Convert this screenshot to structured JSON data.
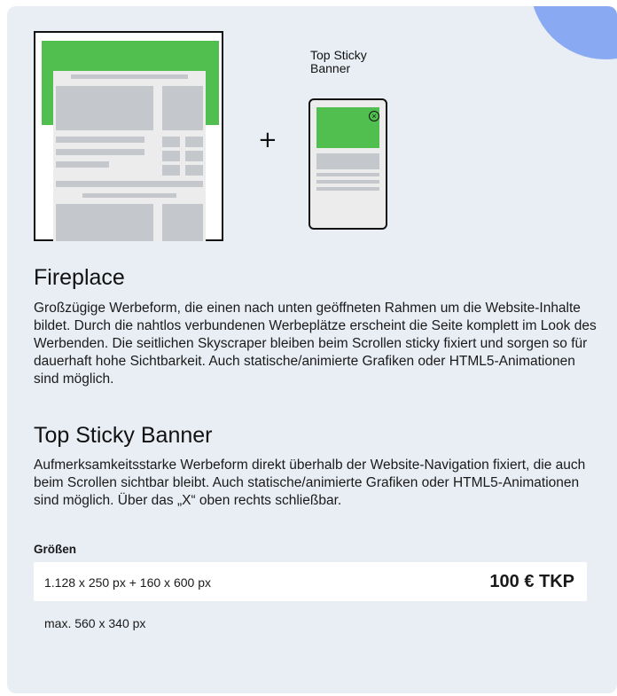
{
  "illustration": {
    "plus_symbol": "+",
    "sticky_label_line1": "Top Sticky",
    "sticky_label_line2": "Banner",
    "close_symbol": "×"
  },
  "sections": [
    {
      "title": "Fireplace",
      "text": "Großzügige Werbeform, die einen nach unten geöffneten Rahmen um die Website-Inhalte bildet. Durch die nahtlos verbundenen Werbeplätze erscheint die Seite komplett im Look des Werbenden. Die seitlichen Skyscraper bleiben beim Scrollen sticky fixiert und sorgen so für dauerhaft hohe Sichtbarkeit. Auch statische/animierte Grafiken oder HTML5-Animationen sind möglich."
    },
    {
      "title": "Top Sticky Banner",
      "text": "Aufmerksamkeitsstarke Werbeform direkt überhalb der Website-Navigation fixiert, die auch beim Scrollen sichtbar bleibt. Auch statische/animierte Grafiken oder HTML5-Animationen sind möglich. Über das „X“ oben rechts schließbar."
    }
  ],
  "sizes": {
    "label": "Größen",
    "primary": "1.128 x 250 px + 160 x 600 px",
    "price": "100 € TKP",
    "secondary": "max. 560 x 340 px"
  },
  "colors": {
    "card_bg": "#e9eef5",
    "accent_green": "#51bf50",
    "accent_blue": "#89a9f2"
  }
}
